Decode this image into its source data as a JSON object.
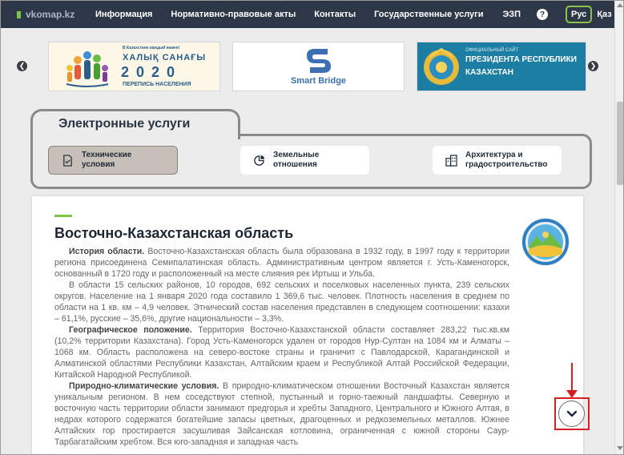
{
  "nav": {
    "logo": "vkomap.kz",
    "items": [
      "Информация",
      "Нормативно-правовые акты",
      "Контакты",
      "Государственные услуги",
      "ЭЗП"
    ],
    "help": "?",
    "lang_ru": "Рус",
    "lang_kz": "Қаз"
  },
  "banners": {
    "census": {
      "small": "В Казахстане каждый важен!",
      "title": "ХАЛЫҚ САНАҒЫ",
      "year": "2020",
      "subtitle": "ПЕРЕПИСЬ НАСЕЛЕНИЯ"
    },
    "smartbridge": {
      "label": "Smart Bridge"
    },
    "president": {
      "small": "ОФИЦИАЛЬНЫЙ САЙТ",
      "line1": "ПРЕЗИДЕНТА РЕСПУБЛИКИ",
      "line2": "КАЗАХСТАН"
    }
  },
  "services": {
    "title": "Электронные услуги",
    "buttons": [
      {
        "line1": "Технические",
        "line2": "условия",
        "icon": "document-icon"
      },
      {
        "line1": "Земельные",
        "line2": "отношения",
        "icon": "pie-chart-icon"
      },
      {
        "line1": "Архитектура и",
        "line2": "градостроительство",
        "icon": "buildings-icon"
      }
    ]
  },
  "article": {
    "title": "Восточно-Казахстанская область",
    "p1_head": "История области.",
    "p1": " Восточно-Казахстанская область была образована в 1932 году, в 1997 году к территории региона присоединена Семипалатинская область. Административным центром является г. Усть-Каменогорск, основанный в 1720 году и расположенный на месте слияния рек Иртыш и Ульба.",
    "p2": "В области 15 сельских районов, 10 городов, 692 сельских и поселковых населенных пункта, 239 сельских округов. Население на 1 января 2020 года составило 1 369,6 тыс. человек. Плотность населения в среднем по области на 1 кв. км – 4,9 человек. Этнический состав населения представлен в следующем соотношении: казахи – 61,1%, русские – 35,6%, другие национальности – 3,3%.",
    "p3_head": "Географическое положение.",
    "p3": " Территория Восточно-Казахстанской области составляет 283,22 тыс.кв.км (10,2% территории Казахстана). Город Усть-Каменогорск удален от городов Нур-Султан на 1084 км и Алматы – 1068 км. Область расположена на северо-востоке страны и граничит с Павлодарской, Карагандинской и Алматинской областями Республики Казахстан, Алтайским краем и Республикой Алтай Российской Федерации, Китайской Народной Республикой.",
    "p4_head": "Природно-климатические условия.",
    "p4": " В природно-климатическом отношении Восточный Казахстан является уникальным регионом. В нем соседствуют степной, пустынный и горно-таежный ландшафты. Северную и восточную часть территории области занимают предгорья и хребты Западного, Центрального и Южного Алтая, в недрах которого содержатся богатейшие запасы цветных, драгоценных и редкоземельных металлов. Южнее Алтайских гор простирается засушливая Зайсанская котловина, ограниченная с южной стороны Саур-Тарбагатайским хребтом. Вся юго-западная и западная часть"
  },
  "colors": {
    "nav_bg": "#2d3748",
    "accent_green": "#7cc34a",
    "annotation_red": "#d62020"
  }
}
